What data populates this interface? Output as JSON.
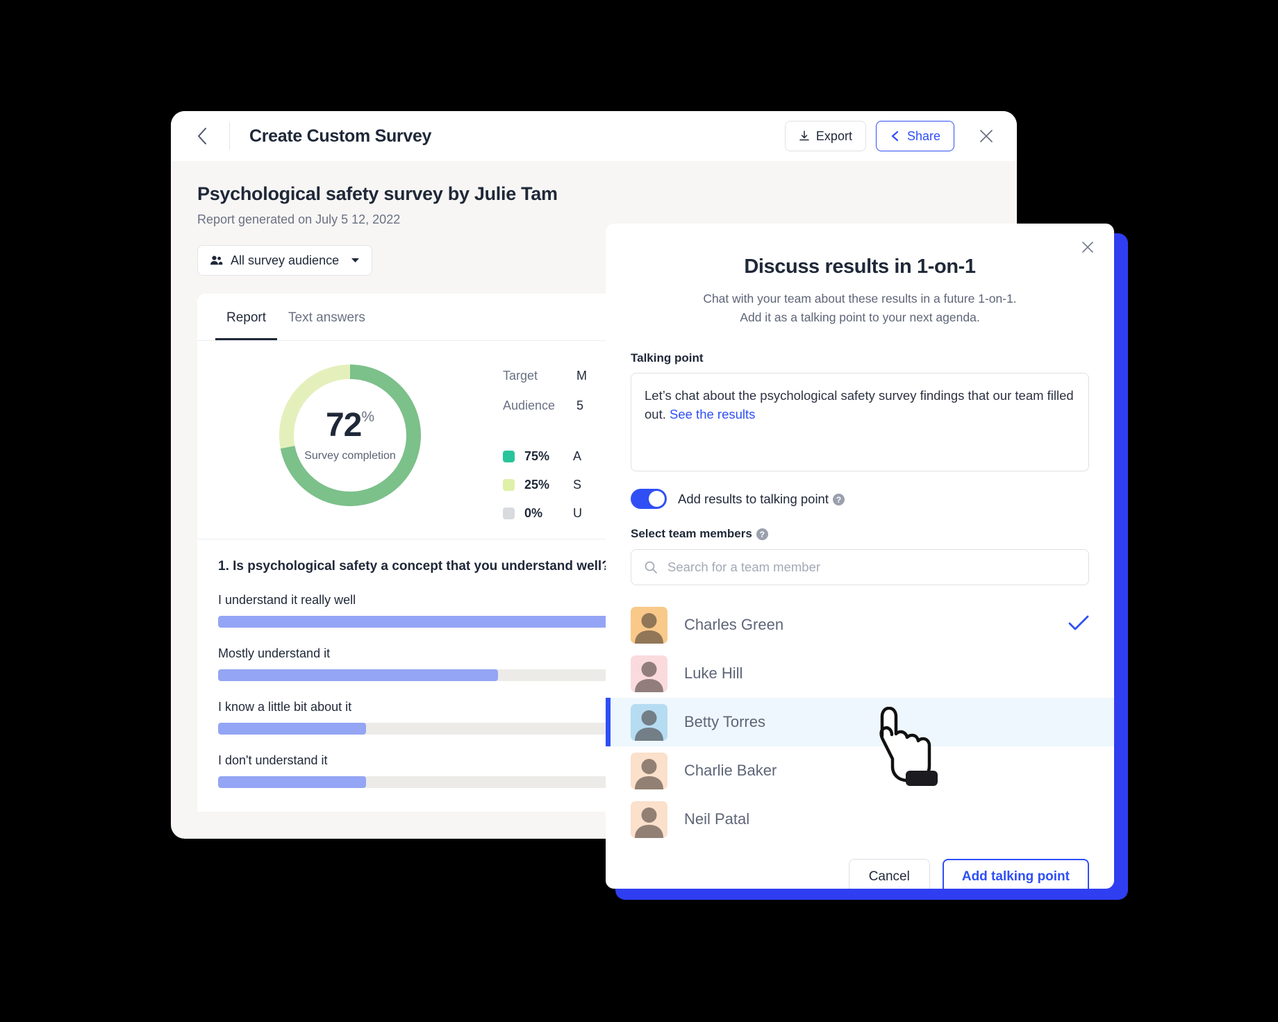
{
  "app": {
    "title": "Create Custom Survey",
    "back_icon": "chevron-left-icon",
    "export_label": "Export",
    "export_icon": "download-icon",
    "share_label": "Share",
    "share_icon": "share-icon",
    "close_icon": "close-icon",
    "report_title": "Psychological safety survey by Julie Tam",
    "report_subtitle": "Report generated on July 5 12, 2022",
    "audience_filter": {
      "label": "All survey audience",
      "icon": "people-icon",
      "caret": "chevron-down-icon"
    },
    "tabs": [
      {
        "label": "Report",
        "active": true
      },
      {
        "label": "Text answers",
        "active": false
      }
    ]
  },
  "chart_data": {
    "type": "pie",
    "title": "Survey completion",
    "center_value": "72",
    "center_unit": "%",
    "center_label": "Survey completion",
    "slices": [
      {
        "label": "Answered",
        "value": 75,
        "display": "75%",
        "color": "#2ac49a"
      },
      {
        "label": "Sent",
        "value": 25,
        "display": "25%",
        "color": "#dff0a8"
      },
      {
        "label": "Unopened",
        "value": 0,
        "display": "0%",
        "color": "#d8dade"
      }
    ],
    "donut_arc_pct": 72,
    "donut_colors": {
      "filled": "#7cc08a",
      "remaining": "#e4f0bc"
    },
    "stats": [
      {
        "key": "Target",
        "value": "M"
      },
      {
        "key": "Audience",
        "value": "5"
      }
    ],
    "legend": [
      {
        "pct": "75%",
        "text": "A",
        "color": "#2ac49a"
      },
      {
        "pct": "25%",
        "text": "S",
        "color": "#dff0a8"
      },
      {
        "pct": "0%",
        "text": "U",
        "color": "#d8dade"
      }
    ]
  },
  "question": {
    "title": "1. Is psychological safety a concept that you understand well?",
    "bars": [
      {
        "label": "I understand it really well",
        "pct": 73
      },
      {
        "label": "Mostly understand it",
        "pct": 36
      },
      {
        "label": "I know a little bit about it",
        "pct": 19
      },
      {
        "label": "I don't understand it",
        "pct": 19
      }
    ],
    "bar_color": "#93a5f4",
    "track_color": "#ecebe8"
  },
  "modal": {
    "close_icon": "close-icon",
    "title": "Discuss results in 1-on-1",
    "subtitle_line1": "Chat with your team about these results in a future 1-on-1.",
    "subtitle_line2": "Add it as a talking point to your next agenda.",
    "talking_point_label": "Talking point",
    "talking_point_text": "Let’s chat about the psychological safety survey findings that our team filled out. ",
    "talking_point_link": "See the results",
    "toggle": {
      "label": "Add results to talking point",
      "on": true,
      "help_icon": "help-icon",
      "help_glyph": "?"
    },
    "members_label": "Select team members",
    "members_help_glyph": "?",
    "search": {
      "placeholder": "Search for a team member",
      "value": "",
      "icon": "search-icon"
    },
    "members": [
      {
        "name": "Charles Green",
        "selected": true,
        "highlighted": false,
        "avatar_bg": "#f9c98a",
        "check_icon": "check-icon"
      },
      {
        "name": "Luke Hill",
        "selected": false,
        "highlighted": false,
        "avatar_bg": "#fadadd"
      },
      {
        "name": "Betty Torres",
        "selected": false,
        "highlighted": true,
        "avatar_bg": "#b6dcf2"
      },
      {
        "name": "Charlie Baker",
        "selected": false,
        "highlighted": false,
        "avatar_bg": "#fbe0cb"
      },
      {
        "name": "Neil Patal",
        "selected": false,
        "highlighted": false,
        "avatar_bg": "#fbe0cb"
      }
    ],
    "cancel_label": "Cancel",
    "primary_label": "Add talking point",
    "accent_color": "#2f4ff5",
    "highlight_bg": "#eef7fd"
  },
  "cursor": {
    "icon": "pointing-hand-cursor"
  }
}
